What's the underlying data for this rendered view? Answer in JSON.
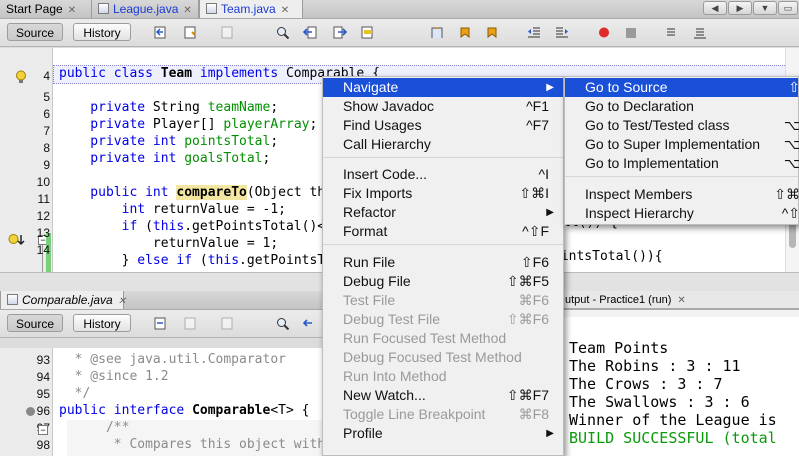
{
  "top_tabs": [
    {
      "label": "Start Page",
      "style": "plain"
    },
    {
      "label": "League.java",
      "style": "link"
    },
    {
      "label": "Team.java",
      "style": "active"
    }
  ],
  "toolbar": {
    "source": "Source",
    "history": "History"
  },
  "editor_top": {
    "line_numbers": [
      "4",
      "5",
      "6",
      "7",
      "8",
      "9",
      "10",
      "11",
      "12",
      "13",
      "14"
    ],
    "lines": [
      [
        {
          "t": "public class ",
          "c": "kw"
        },
        {
          "t": "Team",
          "c": "b"
        },
        {
          "t": " implements ",
          "c": "kw"
        },
        {
          "t": "Comparable {",
          "c": ""
        }
      ],
      [],
      [
        {
          "t": "    private ",
          "c": "kw"
        },
        {
          "t": "String ",
          "c": ""
        },
        {
          "t": "teamName",
          "c": "fld"
        },
        {
          "t": ";",
          "c": ""
        }
      ],
      [
        {
          "t": "    private ",
          "c": "kw"
        },
        {
          "t": "Player[] ",
          "c": ""
        },
        {
          "t": "playerArray",
          "c": "fld"
        },
        {
          "t": ";",
          "c": ""
        }
      ],
      [
        {
          "t": "    private int ",
          "c": "kw"
        },
        {
          "t": "pointsTotal",
          "c": "fld"
        },
        {
          "t": ";",
          "c": ""
        }
      ],
      [
        {
          "t": "    private int ",
          "c": "kw"
        },
        {
          "t": "goalsTotal",
          "c": "fld"
        },
        {
          "t": ";",
          "c": ""
        }
      ],
      [],
      [
        {
          "t": "    public int ",
          "c": "kw"
        },
        {
          "t": "compareTo",
          "c": "hlb"
        },
        {
          "t": "(Object th",
          "c": ""
        }
      ],
      [
        {
          "t": "        int ",
          "c": "kw"
        },
        {
          "t": "returnValue = -1;",
          "c": ""
        }
      ],
      [
        {
          "t": "        if ",
          "c": "kw"
        },
        {
          "t": "(",
          "c": ""
        },
        {
          "t": "this",
          "c": "kw"
        },
        {
          "t": ".getPointsTotal()<",
          "c": ""
        }
      ],
      [
        {
          "t": "            returnValue = 1;",
          "c": ""
        }
      ],
      [
        {
          "t": "        } ",
          "c": ""
        },
        {
          "t": "else if ",
          "c": "kw"
        },
        {
          "t": "(",
          "c": ""
        },
        {
          "t": "this",
          "c": "kw"
        },
        {
          "t": ".getPointsT",
          "c": ""
        }
      ]
    ],
    "right_fragments": {
      "line12": "ll()) {",
      "line14": "pintsTotal()){"
    }
  },
  "bottom_tab": {
    "label": "Comparable.java"
  },
  "editor_bottom": {
    "line_numbers": [
      "93",
      "94",
      "95",
      "96",
      "97",
      "98"
    ],
    "lines": [
      [
        {
          "t": "  * @see java.util.Comparator",
          "c": "cm"
        }
      ],
      [
        {
          "t": "  * @since 1.2",
          "c": "cm"
        }
      ],
      [
        {
          "t": "  */",
          "c": "cm"
        }
      ],
      [
        {
          "t": "public interface ",
          "c": "kw"
        },
        {
          "t": "Comparable",
          "c": "b"
        },
        {
          "t": "<T> {",
          "c": ""
        }
      ],
      [
        {
          "t": "      /**",
          "c": "cm"
        }
      ],
      [
        {
          "t": "       * Compares this object with",
          "c": "cm"
        }
      ]
    ]
  },
  "output": {
    "tab_label": "utput - Practice1 (run)",
    "lines": [
      "Team Points",
      "The Robins : 3 : 11",
      "The Crows : 3 : 7",
      "The Swallows : 3 : 6",
      "Winner of the League is"
    ],
    "build_line": "BUILD SUCCESSFUL (total",
    "colors": {
      "build": "#0a9a0a"
    }
  },
  "context_menu": {
    "items": [
      {
        "label": "Navigate",
        "shortcut": "",
        "submenu": true,
        "highlighted": true
      },
      {
        "label": "Show Javadoc",
        "shortcut": "^F1"
      },
      {
        "label": "Find Usages",
        "shortcut": "^F7"
      },
      {
        "label": "Call Hierarchy",
        "shortcut": ""
      },
      {
        "sep": true
      },
      {
        "label": "Insert Code...",
        "shortcut": "^I"
      },
      {
        "label": "Fix Imports",
        "shortcut": "⇧⌘I"
      },
      {
        "label": "Refactor",
        "shortcut": "",
        "submenu": true
      },
      {
        "label": "Format",
        "shortcut": "^⇧F"
      },
      {
        "sep": true
      },
      {
        "label": "Run File",
        "shortcut": "⇧F6"
      },
      {
        "label": "Debug File",
        "shortcut": "⇧⌘F5"
      },
      {
        "label": "Test File",
        "shortcut": "⌘F6",
        "disabled": true
      },
      {
        "label": "Debug Test File",
        "shortcut": "⇧⌘F6",
        "disabled": true
      },
      {
        "label": "Run Focused Test Method",
        "shortcut": "",
        "disabled": true
      },
      {
        "label": "Debug Focused Test Method",
        "shortcut": "",
        "disabled": true
      },
      {
        "label": "Run Into Method",
        "shortcut": "",
        "disabled": true
      },
      {
        "label": "New Watch...",
        "shortcut": "⇧⌘F7"
      },
      {
        "label": "Toggle Line Breakpoint",
        "shortcut": "⌘F8",
        "disabled": true
      },
      {
        "label": "Profile",
        "shortcut": "",
        "submenu": true
      }
    ]
  },
  "submenu": {
    "items": [
      {
        "label": "Go to Source",
        "shortcut": "⇧",
        "highlighted": true
      },
      {
        "label": "Go to Declaration",
        "shortcut": ""
      },
      {
        "label": "Go to Test/Tested class",
        "shortcut": "⌥"
      },
      {
        "label": "Go to Super Implementation",
        "shortcut": "⌥"
      },
      {
        "label": "Go to Implementation",
        "shortcut": "⌥"
      },
      {
        "sep": true
      },
      {
        "label": "Inspect Members",
        "shortcut": "⇧⌘"
      },
      {
        "label": "Inspect Hierarchy",
        "shortcut": "^⇧"
      }
    ]
  },
  "colors": {
    "keyword": "#0000e6",
    "field": "#009000",
    "highlight": "#1a4fd8",
    "comment": "#8a8a8a"
  }
}
